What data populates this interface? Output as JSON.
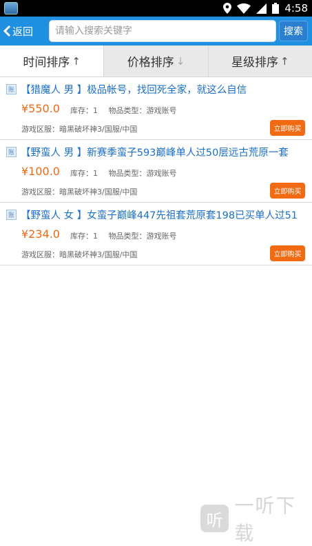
{
  "status_bar": {
    "time": "4:58",
    "icons": [
      "app-icon",
      "location-icon",
      "wifi-icon",
      "signal-icon",
      "battery-icon"
    ]
  },
  "header": {
    "back_label": "返回",
    "search_placeholder": "请输入搜索关键字",
    "search_value": "",
    "search_button": "搜索"
  },
  "sort_tabs": [
    {
      "label": "时间排序",
      "arrow": "↑",
      "active": true
    },
    {
      "label": "价格排序",
      "arrow": "↓",
      "active": false
    },
    {
      "label": "星级排序",
      "arrow": "↑",
      "active": false
    }
  ],
  "items": [
    {
      "icon_glyph": "账",
      "title": "【猎魔人 男 】极品帐号，找回死全家，就这么自信",
      "price": "¥550.0",
      "stock": "库存：1",
      "type": "物品类型：游戏账号",
      "server": "游戏区服：暗黑破坏神3/国服/中国",
      "buy_label": "立即购买"
    },
    {
      "icon_glyph": "账",
      "title": "【野蛮人 男 】新赛季蛮子593巅峰单人过50层远古荒原一套",
      "price": "¥100.0",
      "stock": "库存：1",
      "type": "物品类型：游戏账号",
      "server": "游戏区服：暗黑破坏神3/国服/中国",
      "buy_label": "立即购买"
    },
    {
      "icon_glyph": "账",
      "title": "【野蛮人 女 】女蛮子巅峰447先祖套荒原套198已买单人过51",
      "price": "¥234.0",
      "stock": "库存：1",
      "type": "物品类型：游戏账号",
      "server": "游戏区服：暗黑破坏神3/国服/中国",
      "buy_label": "立即购买"
    }
  ],
  "watermark": {
    "logo_glyph": "听",
    "text": "一听下载"
  },
  "colors": {
    "accent": "#1e8fe1",
    "price": "#f06a14",
    "buy_button": "#f26a11",
    "title_link": "#1a6fc6"
  }
}
